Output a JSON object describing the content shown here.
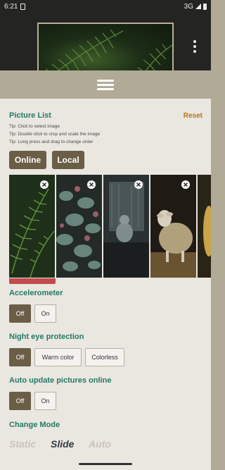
{
  "status_bar": {
    "time": "6:21",
    "network": "3G"
  },
  "picture_list": {
    "title": "Picture List",
    "reset_label": "Reset",
    "tips": [
      "Tip: Click to select image",
      "Tip: Double click to crop and scale the image",
      "Tip: Long press and drag to change order"
    ],
    "tabs": [
      "Online",
      "Local"
    ]
  },
  "accelerometer": {
    "title": "Accelerometer",
    "options": [
      "Off",
      "On"
    ]
  },
  "night_eye": {
    "title": "Night eye protection",
    "options": [
      "Off",
      "Warm color",
      "Colorless"
    ]
  },
  "auto_update": {
    "title": "Auto update pictures online",
    "options": [
      "Off",
      "On"
    ]
  },
  "change_mode": {
    "title": "Change Mode",
    "options": [
      "Static",
      "Slide",
      "Auto"
    ],
    "selected": "Slide"
  },
  "colors": {
    "accent_title": "#237a68",
    "reset": "#b4761e",
    "button_active": "#6b5e47",
    "selected_marker": "#c24b4b"
  }
}
